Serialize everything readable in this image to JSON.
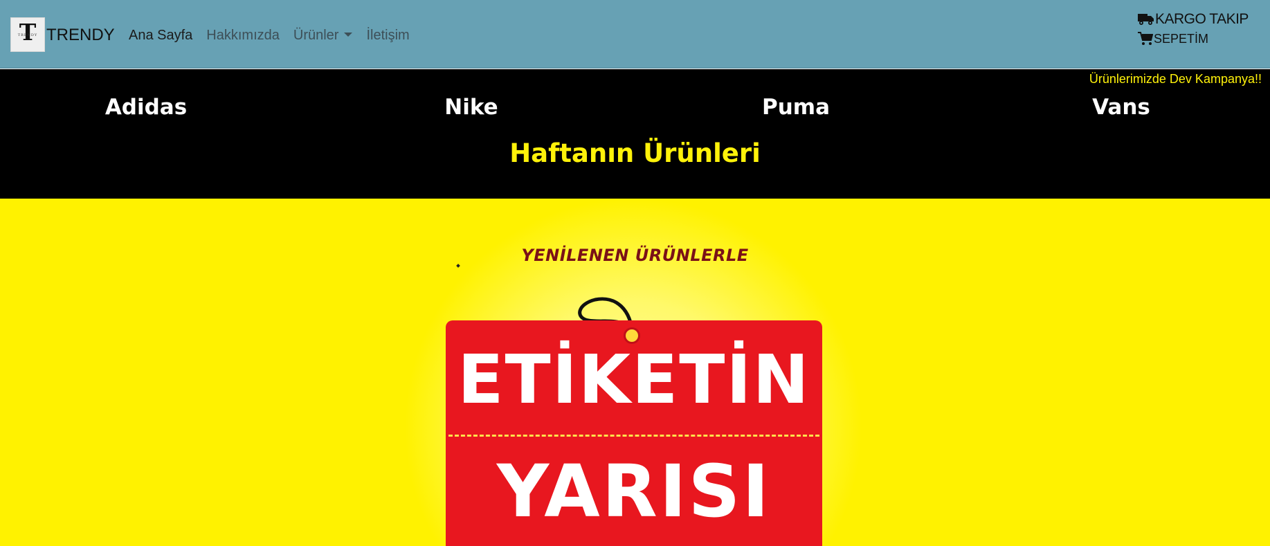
{
  "navbar": {
    "logo_letter": "T",
    "logo_subtext": "TRENDY",
    "brand": "TRENDY",
    "links": [
      {
        "label": "Ana Sayfa",
        "active": true
      },
      {
        "label": "Hakkımızda",
        "active": false
      },
      {
        "label": "Ürünler",
        "active": false,
        "dropdown": true
      },
      {
        "label": "İletişim",
        "active": false
      }
    ],
    "cargo_label": "KARGO TAKIP",
    "cargo_icon": "truck-icon",
    "cart_label": "SEPETİM",
    "cart_icon": "cart-icon",
    "background_color": "#67a1b4"
  },
  "promo": {
    "campaign_text": "Ürünlerimizde Dev Kampanya!!",
    "brands": [
      "Adidas",
      "Nike",
      "Puma",
      "Vans"
    ],
    "week_title": "Haftanın Ürünleri",
    "accent_color": "#fff20a"
  },
  "banner": {
    "subtitle": "YENİLENEN ÜRÜNLERLE",
    "tag_line1": "ETİKETİN",
    "tag_line2": "YARISI",
    "background_color": "#fff200",
    "tag_color": "#e8171f"
  }
}
